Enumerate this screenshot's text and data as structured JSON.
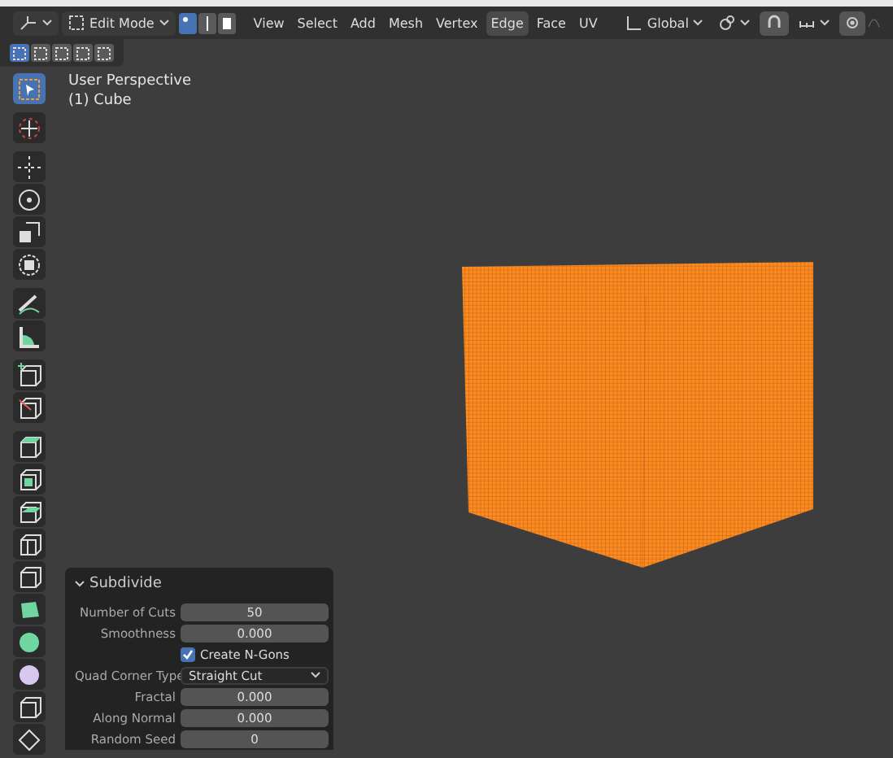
{
  "header": {
    "mode": "Edit Mode",
    "select_modes": [
      {
        "kind": "vertex",
        "selected": true
      },
      {
        "kind": "edge",
        "selected": false
      },
      {
        "kind": "face",
        "selected": false
      }
    ],
    "menu": [
      {
        "label": "View",
        "selected": false
      },
      {
        "label": "Select",
        "selected": false
      },
      {
        "label": "Add",
        "selected": false
      },
      {
        "label": "Mesh",
        "selected": false
      },
      {
        "label": "Vertex",
        "selected": false
      },
      {
        "label": "Edge",
        "selected": true
      },
      {
        "label": "Face",
        "selected": false
      },
      {
        "label": "UV",
        "selected": false
      }
    ],
    "orientation": "Global"
  },
  "select_bar": [
    {
      "selected": true
    },
    {
      "selected": false
    },
    {
      "selected": false
    },
    {
      "selected": false
    },
    {
      "selected": false
    }
  ],
  "viewport": {
    "view_name": "User Perspective",
    "object": "(1) Cube"
  },
  "tools": [
    {
      "kind": "select",
      "selected": true
    },
    {
      "kind": "cursor",
      "selected": false
    },
    {
      "kind": "move",
      "selected": false
    },
    {
      "kind": "rotate",
      "selected": false
    },
    {
      "kind": "scale",
      "selected": false
    },
    {
      "kind": "transform",
      "selected": false
    },
    {
      "kind": "annotate",
      "selected": false
    },
    {
      "kind": "measure",
      "selected": false
    },
    {
      "kind": "add-cube",
      "selected": false
    },
    {
      "kind": "knife",
      "selected": false
    },
    {
      "kind": "extrude",
      "selected": false
    },
    {
      "kind": "inset",
      "selected": false
    },
    {
      "kind": "bevel",
      "selected": false
    },
    {
      "kind": "loop-cut",
      "selected": false
    },
    {
      "kind": "cube",
      "selected": false
    },
    {
      "kind": "poly",
      "selected": false
    },
    {
      "kind": "spin",
      "selected": false
    },
    {
      "kind": "sphere",
      "selected": false
    },
    {
      "kind": "cube",
      "selected": false
    },
    {
      "kind": "randomize",
      "selected": false
    }
  ],
  "operator_panel": {
    "title": "Subdivide",
    "rows": [
      {
        "kind": "number",
        "label": "Number of Cuts",
        "value": "50"
      },
      {
        "kind": "number",
        "label": "Smoothness",
        "value": "0.000"
      },
      {
        "kind": "checkbox",
        "text": "Create N-Gons",
        "checked": true
      },
      {
        "kind": "dropdown",
        "label": "Quad Corner Type",
        "value": "Straight Cut"
      },
      {
        "kind": "number",
        "label": "Fractal",
        "value": "0.000"
      },
      {
        "kind": "number",
        "label": "Along Normal",
        "value": "0.000"
      },
      {
        "kind": "number",
        "label": "Random Seed",
        "value": "0"
      }
    ]
  }
}
